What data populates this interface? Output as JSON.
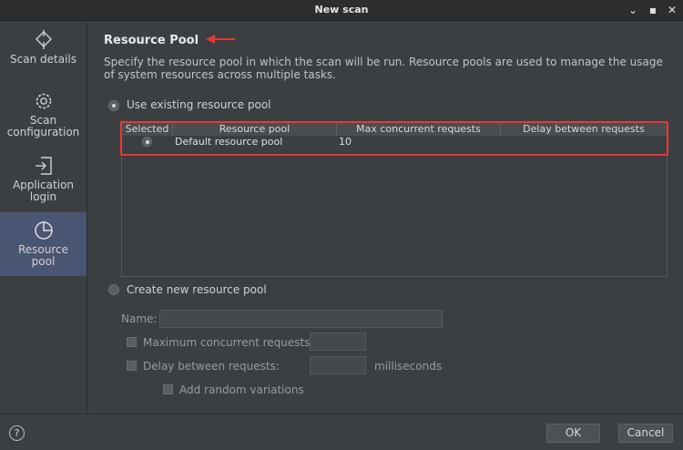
{
  "window": {
    "title": "New scan",
    "controls": [
      "⌄",
      "▪",
      "✕"
    ]
  },
  "sidebar": {
    "items": [
      {
        "label": "Scan details",
        "icon": "crosshair-icon",
        "active": false
      },
      {
        "label": "Scan configuration",
        "icon": "gear-icon",
        "active": false
      },
      {
        "label": "Application login",
        "icon": "login-icon",
        "active": false
      },
      {
        "label": "Resource pool",
        "icon": "pie-chart-icon",
        "active": true
      }
    ]
  },
  "main": {
    "heading": "Resource Pool",
    "description": "Specify the resource pool in which the scan will be run. Resource pools are used to manage the usage of system resources across multiple tasks.",
    "use_existing_label": "Use existing resource pool",
    "table": {
      "columns": [
        "Selected",
        "Resource pool",
        "Max concurrent requests",
        "Delay between requests"
      ],
      "rows": [
        {
          "selected": true,
          "pool": "Default resource pool",
          "max": "10",
          "delay": ""
        }
      ]
    },
    "create_new_label": "Create new resource pool",
    "name_label": "Name:",
    "name_value": "",
    "max_concurrent_label": "Maximum concurrent requests:",
    "delay_label": "Delay between requests:",
    "milliseconds_label": "milliseconds",
    "random_variations_label": "Add random variations"
  },
  "footer": {
    "help": "?",
    "ok_label": "OK",
    "cancel_label": "Cancel"
  },
  "colors": {
    "accent": "#4a5573",
    "highlight": "#e53935"
  }
}
